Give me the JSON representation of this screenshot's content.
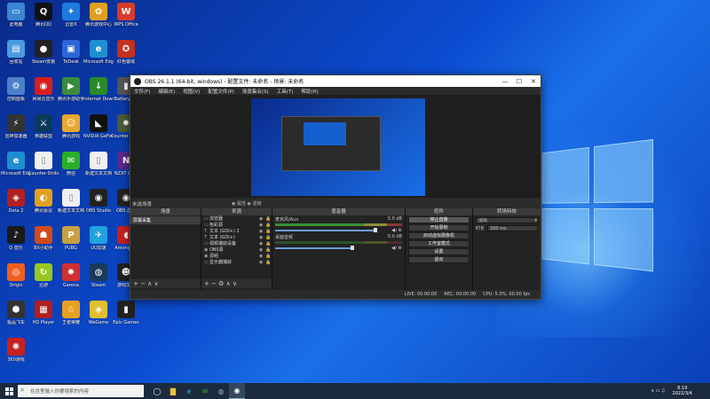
{
  "desktop": {
    "icons": [
      {
        "label": "此电脑",
        "color": "#3a86d4",
        "glyph": "▭"
      },
      {
        "label": "腾讯QQ",
        "color": "#111",
        "glyph": "Q"
      },
      {
        "label": "迅雷X",
        "color": "#1d7be0",
        "glyph": "✦"
      },
      {
        "label": "腾讯游戏中心",
        "color": "#e0a020",
        "glyph": "✿"
      },
      {
        "label": "WPS Office",
        "color": "#d63b2b",
        "glyph": "W"
      },
      {
        "label": "回收站",
        "color": "#4a9ae0",
        "glyph": "▤"
      },
      {
        "label": "Steam安装",
        "color": "#222",
        "glyph": "●"
      },
      {
        "label": "ToDesk",
        "color": "#2c66d8",
        "glyph": "▣"
      },
      {
        "label": "Microsoft Edge",
        "color": "#1e8fd0",
        "glyph": "e"
      },
      {
        "label": "红色警戒",
        "color": "#c23020",
        "glyph": "✪"
      },
      {
        "label": "控制面板",
        "color": "#4a80c8",
        "glyph": "⚙"
      },
      {
        "label": "网易云音乐",
        "color": "#d81e1e",
        "glyph": "◉"
      },
      {
        "label": "腾讯手游助手",
        "color": "#3a8c3a",
        "glyph": "▶"
      },
      {
        "label": "Internet Downloader",
        "color": "#2a8a2a",
        "glyph": "↓"
      },
      {
        "label": "BatteryBar",
        "color": "#555",
        "glyph": "▮"
      },
      {
        "label": "雷神加速器",
        "color": "#333",
        "glyph": "⚡"
      },
      {
        "label": "英雄联盟",
        "color": "#0a3a5a",
        "glyph": "⚔"
      },
      {
        "label": "腾讯游戏",
        "color": "#e8a830",
        "glyph": "☺"
      },
      {
        "label": "NVIDIA GeForce",
        "color": "#111",
        "glyph": "◣"
      },
      {
        "label": "Counter Strike",
        "color": "#4a5a3a",
        "glyph": "✸"
      },
      {
        "label": "Microsoft Edge",
        "color": "#1e8fd0",
        "glyph": "e"
      },
      {
        "label": "Counter-Strike Global",
        "color": "#f0f0f0",
        "glyph": "▯"
      },
      {
        "label": "微信",
        "color": "#2aae2a",
        "glyph": "✉"
      },
      {
        "label": "新建文本文档",
        "color": "#f0f0f0",
        "glyph": "▯"
      },
      {
        "label": "NZXT CAM",
        "color": "#5a2a8a",
        "glyph": "N"
      },
      {
        "label": "Dota 2",
        "color": "#b02020",
        "glyph": "◈"
      },
      {
        "label": "腾讯会议",
        "color": "#e0a020",
        "glyph": "◐"
      },
      {
        "label": "新建文本文档",
        "color": "#f0f0f0",
        "glyph": "▯"
      },
      {
        "label": "OBS Studio",
        "color": "#222",
        "glyph": "◉"
      },
      {
        "label": "OBS 虚拟",
        "color": "#222",
        "glyph": "◉"
      },
      {
        "label": "Q 音乐",
        "color": "#1a1a1a",
        "glyph": "♪"
      },
      {
        "label": "BX小助手",
        "color": "#d24a1a",
        "glyph": "☗"
      },
      {
        "label": "PUBG",
        "color": "#c8a040",
        "glyph": "P"
      },
      {
        "label": "UU加速",
        "color": "#22a0e0",
        "glyph": "✈"
      },
      {
        "label": "Among Us",
        "color": "#c82020",
        "glyph": "◖"
      },
      {
        "label": "Origin",
        "color": "#f06020",
        "glyph": "◎"
      },
      {
        "label": "迅游",
        "color": "#9ac820",
        "glyph": "↻"
      },
      {
        "label": "Garena",
        "color": "#d03030",
        "glyph": "✹"
      },
      {
        "label": "Steam",
        "color": "#1b3a5a",
        "glyph": "◍"
      },
      {
        "label": "游戏加加",
        "color": "#222",
        "glyph": "☻"
      },
      {
        "label": "极品飞车",
        "color": "#333",
        "glyph": "⬢"
      },
      {
        "label": "HD Player",
        "color": "#b02020",
        "glyph": "▦"
      },
      {
        "label": "王者荣耀",
        "color": "#e8a020",
        "glyph": "☆"
      },
      {
        "label": "WeGame",
        "color": "#e0c030",
        "glyph": "◈"
      },
      {
        "label": "Epic Games",
        "color": "#222",
        "glyph": "▮"
      },
      {
        "label": "360游戏",
        "color": "#c82020",
        "glyph": "✺"
      }
    ]
  },
  "obs": {
    "title": "OBS 26.1.1 (64-bit, windows) - 配置文件: 未命名 - 场景: 未命名",
    "menus": [
      "文件(F)",
      "编辑(E)",
      "视图(V)",
      "配置文件(P)",
      "场景集合(S)",
      "工具(T)",
      "帮助(H)"
    ],
    "scene_status": "未选场景",
    "prop_buttons": "◉ 属性   ◉ 滤镜",
    "docks": {
      "scenes_title": "场景",
      "sources_title": "来源",
      "mixer_title": "混音器",
      "controls_title": "控件",
      "transitions_title": "转场特效"
    },
    "scene_items": [
      "屏幕采集"
    ],
    "sources": [
      {
        "icon": "▭",
        "name": "浏览器"
      },
      {
        "icon": "▭",
        "name": "色彩源"
      },
      {
        "icon": "T",
        "name": "文本 (GDI+) 2"
      },
      {
        "icon": "T",
        "name": "文本 (GDI+)"
      },
      {
        "icon": "▭",
        "name": "视频捕获设备"
      },
      {
        "icon": "◉",
        "name": "OBS源"
      },
      {
        "icon": "◉",
        "name": "源组"
      },
      {
        "icon": "▭",
        "name": "显示器捕获"
      }
    ],
    "mixer": [
      {
        "name": "麦克风/Aux",
        "db": "0.0 dB"
      },
      {
        "name": "桌面音频",
        "db": "0.0 dB"
      }
    ],
    "controls": [
      "停止直播",
      "开始录制",
      "启动虚拟摄像机",
      "工作室模式",
      "设置",
      "退出"
    ],
    "transition": {
      "type": "淡出",
      "duration_label": "时长",
      "duration": "300 ms"
    },
    "status": {
      "live": "LIVE: 00:00:00",
      "rec": "REC: 00:00:00",
      "cpu": "CPU: 5.0%, 60.00 fps"
    },
    "dock_buttons": "+ − ∧ ∨"
  },
  "taskbar": {
    "search_placeholder": "在这里输入你要搜索的内容",
    "time": "8:19",
    "date": "2022/3/4"
  },
  "colors": {
    "accent": "#1a6fe8",
    "obs_bg": "#2b2b2b"
  }
}
